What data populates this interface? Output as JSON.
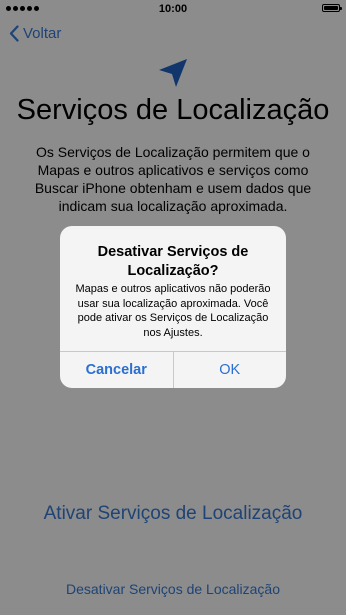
{
  "status_bar": {
    "time": "10:00"
  },
  "nav": {
    "back_label": "Voltar"
  },
  "page": {
    "title": "Serviços de Localização",
    "body": "Os Serviços de Localização permitem que o Mapas e outros aplicativos e serviços como Buscar iPhone obtenham e usem dados que indicam sua localização aproximada.",
    "enable_label": "Ativar Serviços de Localização",
    "disable_label": "Desativar Serviços de Localização"
  },
  "alert": {
    "title": "Desativar Serviços de Localização?",
    "message": "Mapas e outros aplicativos não poderão usar sua localização aproximada. Você pode ativar os Serviços de Localização nos Ajustes.",
    "cancel_label": "Cancelar",
    "ok_label": "OK"
  },
  "colors": {
    "accent": "#3a7bd5",
    "location_icon": "#1e63c4"
  },
  "icons": [
    "back-chevron-icon",
    "location-arrow-icon",
    "battery-icon",
    "signal-icon"
  ]
}
